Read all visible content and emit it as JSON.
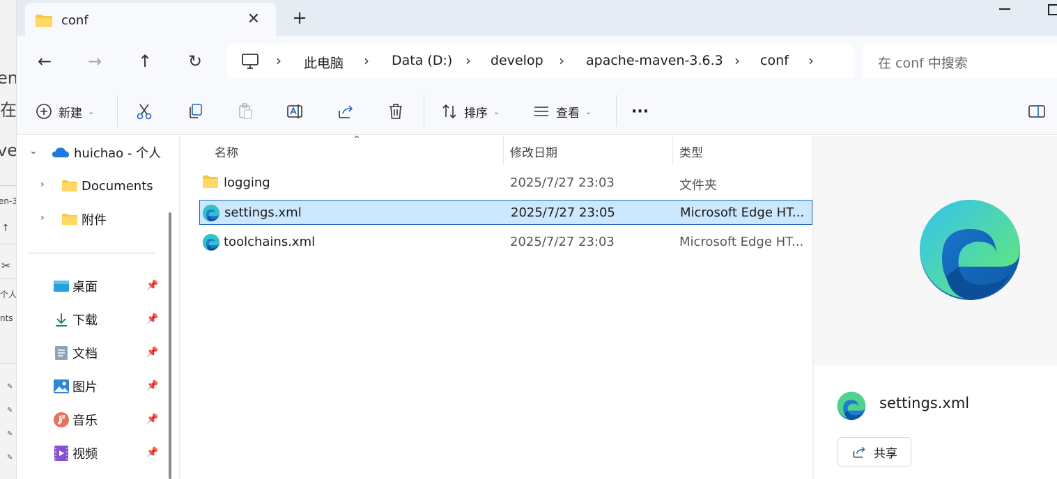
{
  "background_window": {
    "fragments": [
      "en",
      "在",
      "ve",
      "en-3.",
      "↑",
      "个人",
      "nts"
    ]
  },
  "tab": {
    "title": "conf",
    "close_glyph": "✕",
    "new_tab_glyph": "+"
  },
  "nav": {
    "back_glyph": "←",
    "forward_glyph": "→",
    "up_glyph": "↑",
    "refresh_glyph": "↻",
    "breadcrumbs": [
      "此电脑",
      "Data (D:)",
      "develop",
      "apache-maven-3.6.3",
      "conf"
    ],
    "separator_glyph": "›",
    "search_placeholder": "在 conf 中搜索"
  },
  "commands": {
    "new_label": "新建",
    "sort_label": "排序",
    "view_label": "查看",
    "more_glyph": "···"
  },
  "navpane": {
    "onedrive_label": "huichao - 个人",
    "onedrive_children": [
      "Documents",
      "附件"
    ],
    "quick_access": [
      {
        "label": "桌面",
        "icon": "desktop-icon"
      },
      {
        "label": "下载",
        "icon": "download-icon"
      },
      {
        "label": "文档",
        "icon": "document-icon"
      },
      {
        "label": "图片",
        "icon": "pictures-icon"
      },
      {
        "label": "音乐",
        "icon": "music-icon"
      },
      {
        "label": "视频",
        "icon": "video-icon"
      }
    ]
  },
  "filelist": {
    "columns": {
      "name": "名称",
      "modified": "修改日期",
      "type": "类型"
    },
    "rows": [
      {
        "name": "logging",
        "modified": "2025/7/27 23:03",
        "type": "文件夹",
        "icon": "folder-icon",
        "selected": false
      },
      {
        "name": "settings.xml",
        "modified": "2025/7/27 23:05",
        "type": "Microsoft Edge HT...",
        "icon": "edge-file-icon",
        "selected": true
      },
      {
        "name": "toolchains.xml",
        "modified": "2025/7/27 23:03",
        "type": "Microsoft Edge HT...",
        "icon": "edge-file-icon",
        "selected": false
      }
    ]
  },
  "preview": {
    "file_name": "settings.xml",
    "share_label": "共享"
  },
  "colors": {
    "accent": "#1f66c2",
    "selection": "#cce8ff",
    "tabstrip": "#e6ecf3",
    "toolbar": "#f7f9fc",
    "folder": "#f7c948"
  }
}
